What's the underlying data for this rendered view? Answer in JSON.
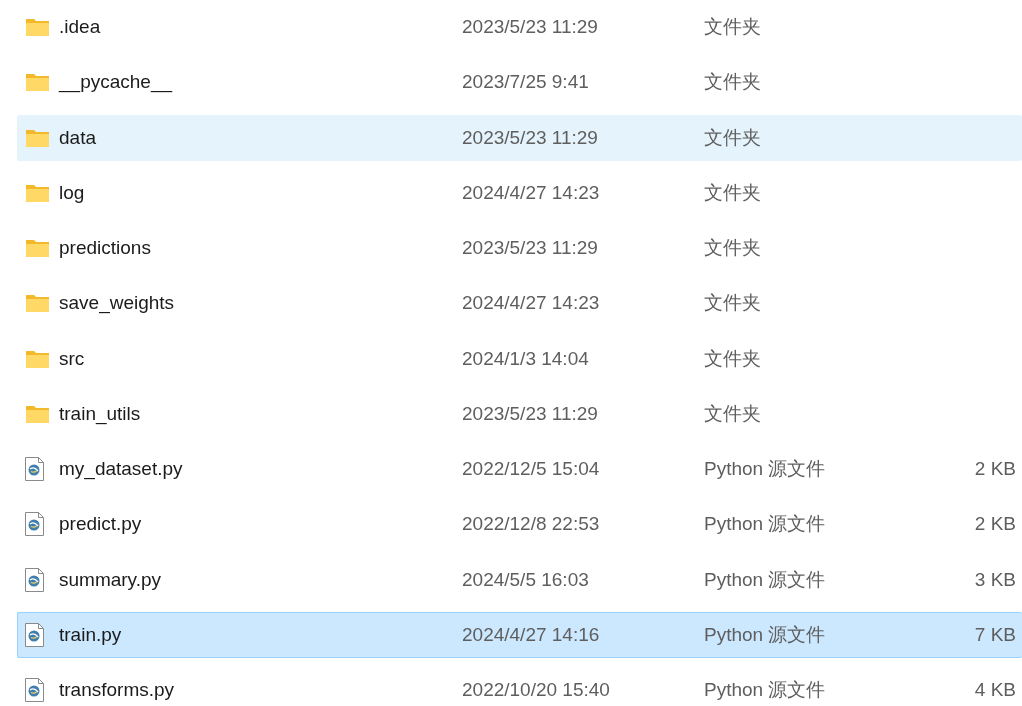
{
  "files": [
    {
      "kind": "folder",
      "name": ".idea",
      "modified": "2023/5/23 11:29",
      "type": "文件夹",
      "hovered": false,
      "selected": false
    },
    {
      "kind": "folder",
      "name": "__pycache__",
      "modified": "2023/7/25 9:41",
      "type": "文件夹",
      "hovered": false,
      "selected": false
    },
    {
      "kind": "folder",
      "name": "data",
      "modified": "2023/5/23 11:29",
      "type": "文件夹",
      "hovered": true,
      "selected": false
    },
    {
      "kind": "folder",
      "name": "log",
      "modified": "2024/4/27 14:23",
      "type": "文件夹",
      "hovered": false,
      "selected": false
    },
    {
      "kind": "folder",
      "name": "predictions",
      "modified": "2023/5/23 11:29",
      "type": "文件夹",
      "hovered": false,
      "selected": false
    },
    {
      "kind": "folder",
      "name": "save_weights",
      "modified": "2024/4/27 14:23",
      "type": "文件夹",
      "hovered": false,
      "selected": false
    },
    {
      "kind": "folder",
      "name": "src",
      "modified": "2024/1/3 14:04",
      "type": "文件夹",
      "hovered": false,
      "selected": false
    },
    {
      "kind": "folder",
      "name": "train_utils",
      "modified": "2023/5/23 11:29",
      "type": "文件夹",
      "hovered": false,
      "selected": false
    },
    {
      "kind": "python",
      "name": "my_dataset.py",
      "modified": "2022/12/5 15:04",
      "type": "Python 源文件",
      "size": "2 KB",
      "hovered": false,
      "selected": false
    },
    {
      "kind": "python",
      "name": "predict.py",
      "modified": "2022/12/8 22:53",
      "type": "Python 源文件",
      "size": "2 KB",
      "hovered": false,
      "selected": false
    },
    {
      "kind": "python",
      "name": "summary.py",
      "modified": "2024/5/5 16:03",
      "type": "Python 源文件",
      "size": "3 KB",
      "hovered": false,
      "selected": false
    },
    {
      "kind": "python",
      "name": "train.py",
      "modified": "2024/4/27 14:16",
      "type": "Python 源文件",
      "size": "7 KB",
      "hovered": false,
      "selected": true
    },
    {
      "kind": "python",
      "name": "transforms.py",
      "modified": "2022/10/20 15:40",
      "type": "Python 源文件",
      "size": "4 KB",
      "hovered": false,
      "selected": false
    }
  ]
}
